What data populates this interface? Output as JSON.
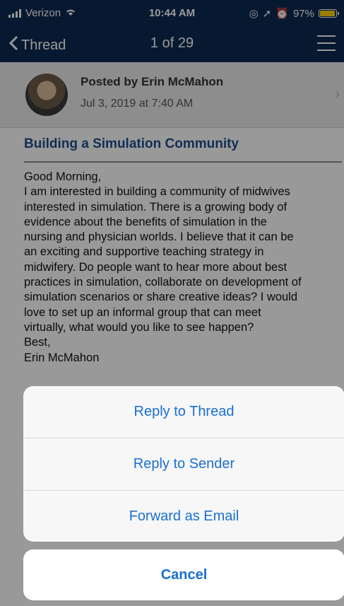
{
  "status": {
    "carrier": "Verizon",
    "time": "10:44 AM",
    "battery": "97%",
    "battery_level": 0.97
  },
  "nav": {
    "back_label": "Thread",
    "title": "1 of 29"
  },
  "post": {
    "author": "Posted by Erin McMahon",
    "date": "Jul 3, 2019 at 7:40 AM"
  },
  "subject": "Building a Simulation Community",
  "body_lines": [
    "Good Morning,",
    "I am interested in building a community of midwives",
    "interested in simulation.  There is a growing body of",
    "evidence about the benefits of simulation in the",
    "nursing and physician worlds.  I believe that it can be",
    "an exciting and supportive teaching strategy in",
    "midwifery.  Do people want to hear more about best",
    "practices in simulation, collaborate on development of",
    "simulation scenarios or share creative ideas?  I would",
    "love to set up an informal group that can meet",
    "virtually, what would you like to see happen?",
    "Best,",
    "Erin McMahon"
  ],
  "sheet": {
    "actions": [
      "Reply to Thread",
      "Reply to Sender",
      "Forward as Email"
    ],
    "cancel": "Cancel"
  },
  "colors": {
    "nav_bg": "#0d2b52",
    "accent": "#1a6fd0",
    "subject": "#1e4e8c"
  }
}
